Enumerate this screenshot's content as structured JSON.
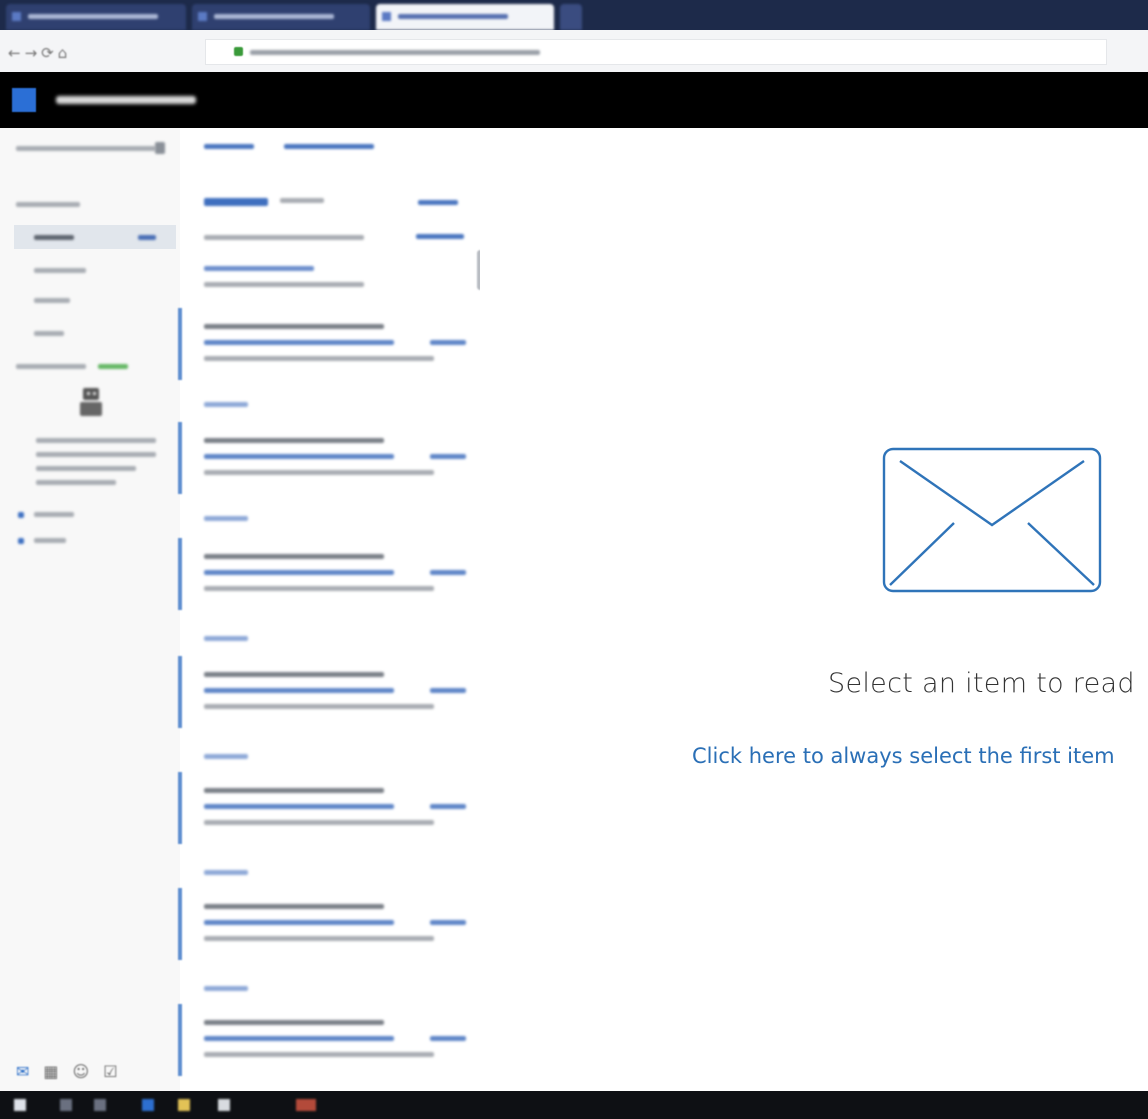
{
  "browser": {
    "tabs": [
      {
        "state": "inactive"
      },
      {
        "state": "inactive"
      },
      {
        "state": "active"
      }
    ]
  },
  "reading_pane": {
    "empty_message": "Select an item to read",
    "first_item_link": "Click here to always select the first item"
  },
  "colors": {
    "suite_bar": "#000000",
    "accent": "#2a6fb6",
    "envelope": "#2f74b9",
    "taskbar": "#0e1014"
  }
}
